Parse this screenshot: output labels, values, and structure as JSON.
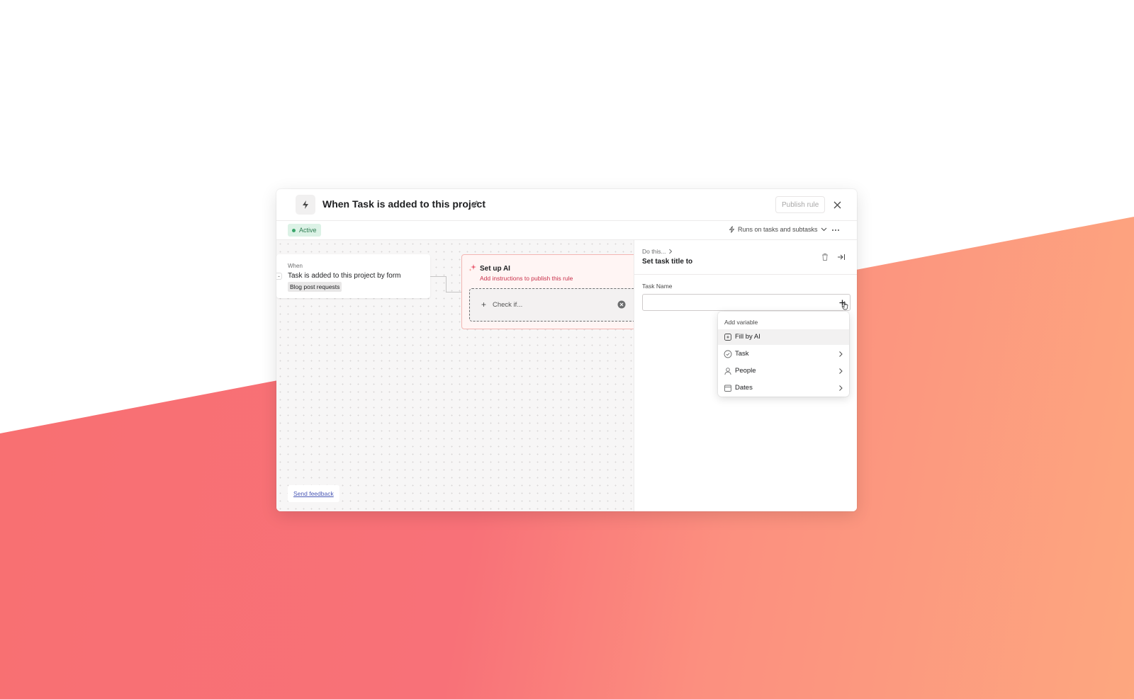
{
  "header": {
    "title": "When Task is added to this project",
    "publish_label": "Publish rule"
  },
  "subbar": {
    "status": "Active",
    "runs_on": "Runs on tasks and subtasks"
  },
  "canvas": {
    "trigger": {
      "label": "When",
      "text": "Task is added to this project by form",
      "chip": "Blog post requests"
    },
    "ai_card": {
      "title": "Set up AI",
      "subtitle": "Add instructions to publish this rule",
      "check_label": "Check if..."
    },
    "feedback_label": "Send feedback"
  },
  "panel": {
    "breadcrumb": "Do this...",
    "title": "Set task title to",
    "field_label": "Task Name",
    "field_value": "",
    "field_placeholder": ""
  },
  "dropdown": {
    "heading": "Add variable",
    "items": [
      {
        "label": "Fill by AI",
        "icon": "ai-sparkle-icon",
        "submenu": false
      },
      {
        "label": "Task",
        "icon": "check-circle-icon",
        "submenu": true
      },
      {
        "label": "People",
        "icon": "person-icon",
        "submenu": true
      },
      {
        "label": "Dates",
        "icon": "calendar-icon",
        "submenu": true
      }
    ]
  },
  "colors": {
    "active_badge_bg": "#dcf2e6",
    "active_badge_text": "#2e7d52",
    "ai_accent": "#c9304a",
    "link": "#4a58b5",
    "bg_gradient_start": "#f87071",
    "bg_gradient_end": "#fda77f"
  }
}
